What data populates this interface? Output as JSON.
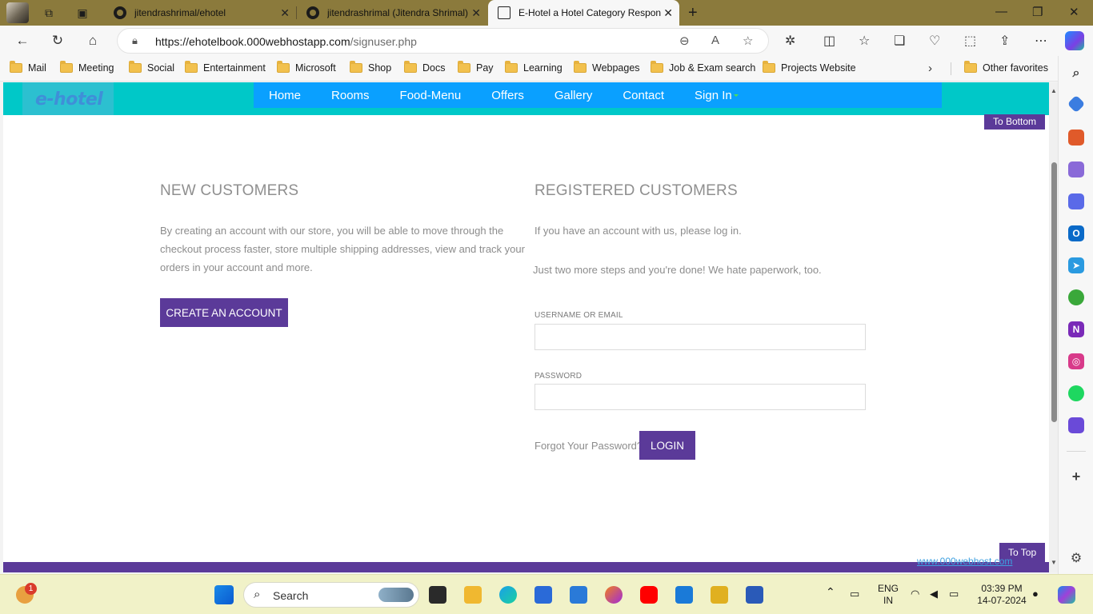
{
  "browser": {
    "tabs": [
      {
        "label": "jitendrashrimal/ehotel"
      },
      {
        "label": "jitendrashrimal (Jitendra Shrimal)"
      },
      {
        "label": "E-Hotel a Hotel Category Respon"
      }
    ],
    "url_host": "https://ehotelbook.000webhostapp.com",
    "url_path": "/signuser.php",
    "favorites": [
      "Mail",
      "Meeting",
      "Social",
      "Entertainment",
      "Microsoft",
      "Shop",
      "Docs",
      "Pay",
      "Learning",
      "Webpages",
      "Job & Exam search",
      "Projects Website"
    ],
    "other_favorites": "Other favorites"
  },
  "site": {
    "logo": "e-hotel",
    "nav": [
      "Home",
      "Rooms",
      "Food-Menu",
      "Offers",
      "Gallery",
      "Contact",
      "Sign In"
    ],
    "to_bottom": "To Bottom",
    "to_top": "To Top",
    "host_link": "www.000webhost.com",
    "new_customers": {
      "title": "NEW CUSTOMERS",
      "text": "By creating an account with our store, you will be able to move through the checkout process faster, store multiple shipping addresses, view and track your orders in your account and more.",
      "button": "CREATE AN ACCOUNT"
    },
    "registered_customers": {
      "title": "REGISTERED CUSTOMERS",
      "text1": "If you have an account with us, please log in.",
      "text2": "Just two more steps and you're done! We hate paperwork, too.",
      "username_label": "USERNAME OR EMAIL",
      "username_value": "",
      "password_label": "PASSWORD",
      "password_value": "",
      "forgot": "Forgot Your Password?",
      "login_button": "LOGIN"
    }
  },
  "taskbar": {
    "search_placeholder": "Search",
    "notification_count": "1",
    "lang_line1": "ENG",
    "lang_line2": "IN",
    "time": "03:39 PM",
    "date": "14-07-2024"
  },
  "colors": {
    "accent_purple": "#5b3a99",
    "header_teal": "#00c8c8",
    "nav_blue": "#0aa0ff"
  }
}
